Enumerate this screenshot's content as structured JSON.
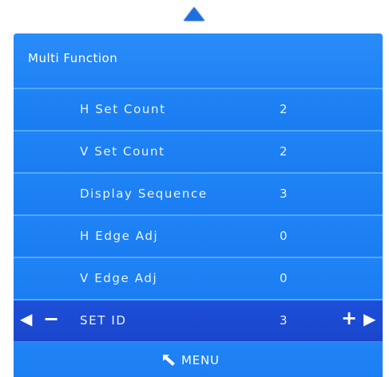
{
  "osd": {
    "title": "Multi Function",
    "items": [
      {
        "label": "H Set Count",
        "value": "2"
      },
      {
        "label": "V Set Count",
        "value": "2"
      },
      {
        "label": "Display Sequence",
        "value": "3"
      },
      {
        "label": "H Edge Adj",
        "value": "0"
      },
      {
        "label": "V Edge Adj",
        "value": "0"
      },
      {
        "label": "SET ID",
        "value": "3"
      }
    ],
    "selected": {
      "left_arrow": "◀",
      "minus": "−",
      "plus": "+",
      "right_arrow": "▶"
    },
    "footer": {
      "menu_label": "MENU",
      "menu_icon": "return-arrow-icon"
    },
    "icons": {
      "up": "up-arrow-icon"
    },
    "colors": {
      "panel": "#1a7df3",
      "selected_row": "#1d4fd8",
      "divider": "#52a9ff",
      "text": "#ffffff"
    }
  }
}
